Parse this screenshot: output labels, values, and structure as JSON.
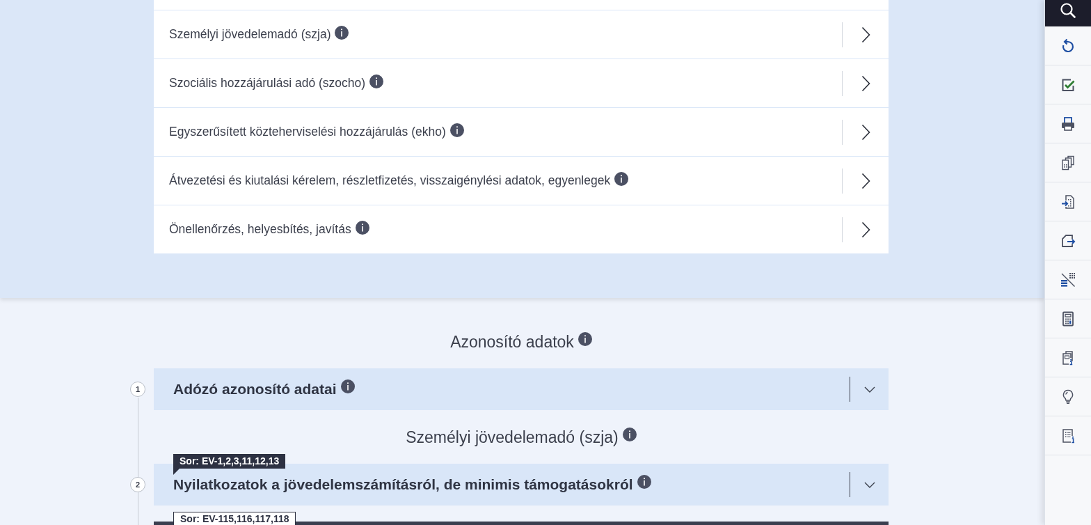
{
  "task_list": {
    "items": [
      {
        "label": "Személyi jövedelemadó (szja)"
      },
      {
        "label": "Szociális hozzájárulási adó (szocho)"
      },
      {
        "label": "Egyszerűsített közteherviselési hozzájárulás (ekho)"
      },
      {
        "label": "Átvezetési és kiutalási kérelem, részletfizetés, visszaigénylési adatok, egyenlegek"
      },
      {
        "label": "Önellenőrzés, helyesbítés, javítás"
      }
    ]
  },
  "sections": [
    {
      "heading": "Azonosító adatok",
      "panels": [
        {
          "number": "1",
          "title": "Adózó azonosító adatai",
          "expanded": false,
          "highlighted": false
        }
      ]
    },
    {
      "heading": "Személyi jövedelemadó (szja)",
      "panels": [
        {
          "number": "2",
          "tag": "Sor: EV-1,2,3,11,12,13",
          "title": "Nyilatkozatok a jövedelemszámításról, de minimis támogatásokról",
          "expanded": false,
          "highlighted": false
        },
        {
          "tag": "Sor: EV-115,116,117,118",
          "highlighted": true
        }
      ]
    }
  ],
  "toolbar": {
    "tools": [
      {
        "kind": "search"
      },
      {
        "kind": "undo"
      },
      {
        "kind": "check"
      },
      {
        "kind": "print"
      },
      {
        "kind": "copies"
      },
      {
        "kind": "import"
      },
      {
        "kind": "export"
      },
      {
        "kind": "grid_off"
      },
      {
        "kind": "calculator"
      },
      {
        "kind": "docs_info"
      },
      {
        "kind": "hint"
      },
      {
        "kind": "list_info"
      }
    ]
  }
}
